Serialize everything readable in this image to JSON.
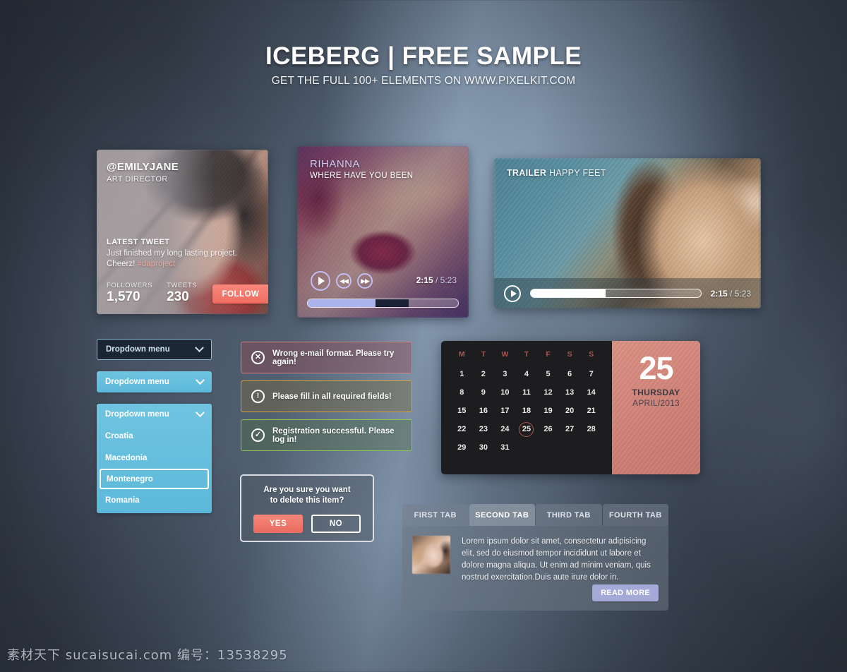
{
  "header": {
    "title": "ICEBERG | FREE SAMPLE",
    "subtitle": "GET THE FULL 100+ ELEMENTS ON WWW.PIXELKIT.COM"
  },
  "profile_card": {
    "handle": "@EMILYJANE",
    "role": "ART DIRECTOR",
    "tweet_label": "LATEST TWEET",
    "tweet_text": "Just finished my long lasting project. Cheerz!",
    "tweet_hashtag": "#daproject",
    "followers_label": "FOLLOWERS",
    "followers_value": "1,570",
    "tweets_label": "TWEETS",
    "tweets_value": "230",
    "follow_button": "FOLLOW",
    "accent_color": "#ef6d60"
  },
  "music_player": {
    "artist": "RIHANNA",
    "track": "WHERE HAVE YOU BEEN",
    "current_time": "2:15",
    "separator": " / ",
    "total_time": "5:23",
    "progress_percent": 45,
    "accent_color": "#adb3ec"
  },
  "video_player": {
    "label": "TRAILER",
    "title": " HAPPY FEET",
    "current_time": "2:15",
    "separator": " / ",
    "total_time": "5:23",
    "progress_percent": 44
  },
  "dropdowns": {
    "closed_dark_label": "Dropdown menu",
    "closed_blue_label": "Dropdown menu",
    "open_label": "Dropdown menu",
    "open_items": [
      {
        "label": "Croatia",
        "selected": false
      },
      {
        "label": "Macedonia",
        "selected": false
      },
      {
        "label": "Montenegro",
        "selected": true
      },
      {
        "label": "Romania",
        "selected": false
      }
    ],
    "accent_color": "#5cb9da"
  },
  "alerts": [
    {
      "type": "error",
      "icon": "close-circle-icon",
      "glyph": "✕",
      "message": "Wrong e-mail format. Please try again!",
      "border_color": "#d97f85"
    },
    {
      "type": "warning",
      "icon": "exclamation-circle-icon",
      "glyph": "!",
      "message": "Please fill in all required fields!",
      "border_color": "#d7a33f"
    },
    {
      "type": "success",
      "icon": "check-circle-icon",
      "glyph": "✓",
      "message": "Registration successful. Please log in!",
      "border_color": "#8fc457"
    }
  ],
  "confirm_dialog": {
    "line1": "Are you sure you want",
    "line2": "to delete this item?",
    "yes_label": "YES",
    "no_label": "NO"
  },
  "calendar": {
    "weekday_headers": [
      "M",
      "T",
      "W",
      "T",
      "F",
      "S",
      "S"
    ],
    "weeks": [
      [
        "1",
        "2",
        "3",
        "4",
        "5",
        "6",
        "7"
      ],
      [
        "8",
        "9",
        "10",
        "11",
        "12",
        "13",
        "14"
      ],
      [
        "15",
        "16",
        "17",
        "18",
        "19",
        "20",
        "21"
      ],
      [
        "22",
        "23",
        "24",
        "25",
        "26",
        "27",
        "28"
      ],
      [
        "29",
        "30",
        "31",
        "",
        "",
        "",
        ""
      ]
    ],
    "today": "25",
    "side_day": "25",
    "side_weekday": "THURSDAY",
    "side_monthyear": "APRIL/2013",
    "accent_color": "#d5877c"
  },
  "tabs": {
    "items": [
      {
        "label": "FIRST TAB",
        "active": false
      },
      {
        "label": "SECOND TAB",
        "active": true
      },
      {
        "label": "THIRD TAB",
        "active": false
      },
      {
        "label": "FOURTH TAB",
        "active": false
      }
    ],
    "body_text": "Lorem ipsum dolor sit amet, consectetur adipisicing elit, sed do eiusmod tempor incididunt ut labore et dolore magna aliqua. Ut enim ad minim veniam, quis nostrud exercitation.Duis aute irure dolor in.",
    "read_more_label": "READ MORE",
    "read_more_color": "#a5a9d8"
  },
  "watermark": "素材天下 sucaisucai.com  编号：13538295"
}
